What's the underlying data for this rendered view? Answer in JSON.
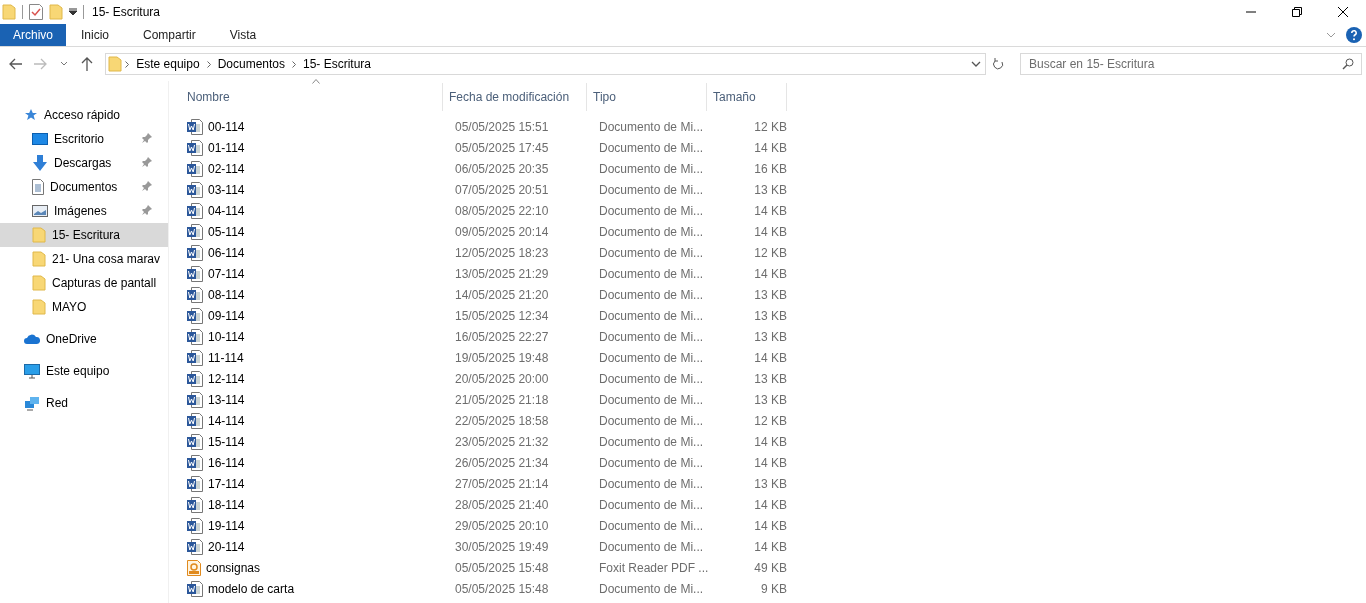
{
  "window": {
    "title": "15- Escritura"
  },
  "ribbon_tabs": [
    {
      "label": "Archivo",
      "selected": true
    },
    {
      "label": "Inicio",
      "selected": false
    },
    {
      "label": "Compartir",
      "selected": false
    },
    {
      "label": "Vista",
      "selected": false
    }
  ],
  "address_bar": {
    "path": [
      "Este equipo",
      "Documentos",
      "15- Escritura"
    ]
  },
  "search": {
    "placeholder": "Buscar en 15- Escritura"
  },
  "sidebar": {
    "items": [
      {
        "label": "Acceso rápido",
        "kind": "quick",
        "pinned": false,
        "selected": false,
        "children": [
          {
            "label": "Escritorio",
            "kind": "desktop",
            "pinned": true,
            "selected": false
          },
          {
            "label": "Descargas",
            "kind": "downloads",
            "pinned": true,
            "selected": false
          },
          {
            "label": "Documentos",
            "kind": "documents",
            "pinned": true,
            "selected": false
          },
          {
            "label": "Imágenes",
            "kind": "images",
            "pinned": true,
            "selected": false
          },
          {
            "label": "15- Escritura",
            "kind": "folder",
            "pinned": false,
            "selected": true
          },
          {
            "label": "21- Una cosa marav",
            "kind": "folder",
            "pinned": false,
            "selected": false
          },
          {
            "label": "Capturas de pantall",
            "kind": "folder",
            "pinned": false,
            "selected": false
          },
          {
            "label": "MAYO",
            "kind": "folder",
            "pinned": false,
            "selected": false
          }
        ]
      },
      {
        "label": "OneDrive",
        "kind": "cloud",
        "pinned": false,
        "selected": false
      },
      {
        "label": "Este equipo",
        "kind": "computer",
        "pinned": false,
        "selected": false
      },
      {
        "label": "Red",
        "kind": "network",
        "pinned": false,
        "selected": false
      }
    ]
  },
  "table": {
    "columns": [
      {
        "label": "Nombre",
        "sorted": true
      },
      {
        "label": "Fecha de modificación",
        "sorted": false
      },
      {
        "label": "Tipo",
        "sorted": false
      },
      {
        "label": "Tamaño",
        "sorted": false
      }
    ],
    "rows": [
      {
        "name": "00-114",
        "date": "05/05/2025 15:51",
        "type": "Documento de Mi...",
        "size": "12 KB",
        "kind": "word"
      },
      {
        "name": "01-114",
        "date": "05/05/2025 17:45",
        "type": "Documento de Mi...",
        "size": "14 KB",
        "kind": "word"
      },
      {
        "name": "02-114",
        "date": "06/05/2025 20:35",
        "type": "Documento de Mi...",
        "size": "16 KB",
        "kind": "word"
      },
      {
        "name": "03-114",
        "date": "07/05/2025 20:51",
        "type": "Documento de Mi...",
        "size": "13 KB",
        "kind": "word"
      },
      {
        "name": "04-114",
        "date": "08/05/2025 22:10",
        "type": "Documento de Mi...",
        "size": "14 KB",
        "kind": "word"
      },
      {
        "name": "05-114",
        "date": "09/05/2025 20:14",
        "type": "Documento de Mi...",
        "size": "14 KB",
        "kind": "word"
      },
      {
        "name": "06-114",
        "date": "12/05/2025 18:23",
        "type": "Documento de Mi...",
        "size": "12 KB",
        "kind": "word"
      },
      {
        "name": "07-114",
        "date": "13/05/2025 21:29",
        "type": "Documento de Mi...",
        "size": "14 KB",
        "kind": "word"
      },
      {
        "name": "08-114",
        "date": "14/05/2025 21:20",
        "type": "Documento de Mi...",
        "size": "13 KB",
        "kind": "word"
      },
      {
        "name": "09-114",
        "date": "15/05/2025 12:34",
        "type": "Documento de Mi...",
        "size": "13 KB",
        "kind": "word"
      },
      {
        "name": "10-114",
        "date": "16/05/2025 22:27",
        "type": "Documento de Mi...",
        "size": "13 KB",
        "kind": "word"
      },
      {
        "name": "11-114",
        "date": "19/05/2025 19:48",
        "type": "Documento de Mi...",
        "size": "14 KB",
        "kind": "word"
      },
      {
        "name": "12-114",
        "date": "20/05/2025 20:00",
        "type": "Documento de Mi...",
        "size": "13 KB",
        "kind": "word"
      },
      {
        "name": "13-114",
        "date": "21/05/2025 21:18",
        "type": "Documento de Mi...",
        "size": "13 KB",
        "kind": "word"
      },
      {
        "name": "14-114",
        "date": "22/05/2025 18:58",
        "type": "Documento de Mi...",
        "size": "12 KB",
        "kind": "word"
      },
      {
        "name": "15-114",
        "date": "23/05/2025 21:32",
        "type": "Documento de Mi...",
        "size": "14 KB",
        "kind": "word"
      },
      {
        "name": "16-114",
        "date": "26/05/2025 21:34",
        "type": "Documento de Mi...",
        "size": "14 KB",
        "kind": "word"
      },
      {
        "name": "17-114",
        "date": "27/05/2025 21:14",
        "type": "Documento de Mi...",
        "size": "13 KB",
        "kind": "word"
      },
      {
        "name": "18-114",
        "date": "28/05/2025 21:40",
        "type": "Documento de Mi...",
        "size": "14 KB",
        "kind": "word"
      },
      {
        "name": "19-114",
        "date": "29/05/2025 20:10",
        "type": "Documento de Mi...",
        "size": "14 KB",
        "kind": "word"
      },
      {
        "name": "20-114",
        "date": "30/05/2025 19:49",
        "type": "Documento de Mi...",
        "size": "14 KB",
        "kind": "word"
      },
      {
        "name": "consignas",
        "date": "05/05/2025 15:48",
        "type": "Foxit Reader PDF ...",
        "size": "49 KB",
        "kind": "pdf"
      },
      {
        "name": "modelo de carta",
        "date": "05/05/2025 15:48",
        "type": "Documento de Mi...",
        "size": "9 KB",
        "kind": "word"
      }
    ]
  }
}
